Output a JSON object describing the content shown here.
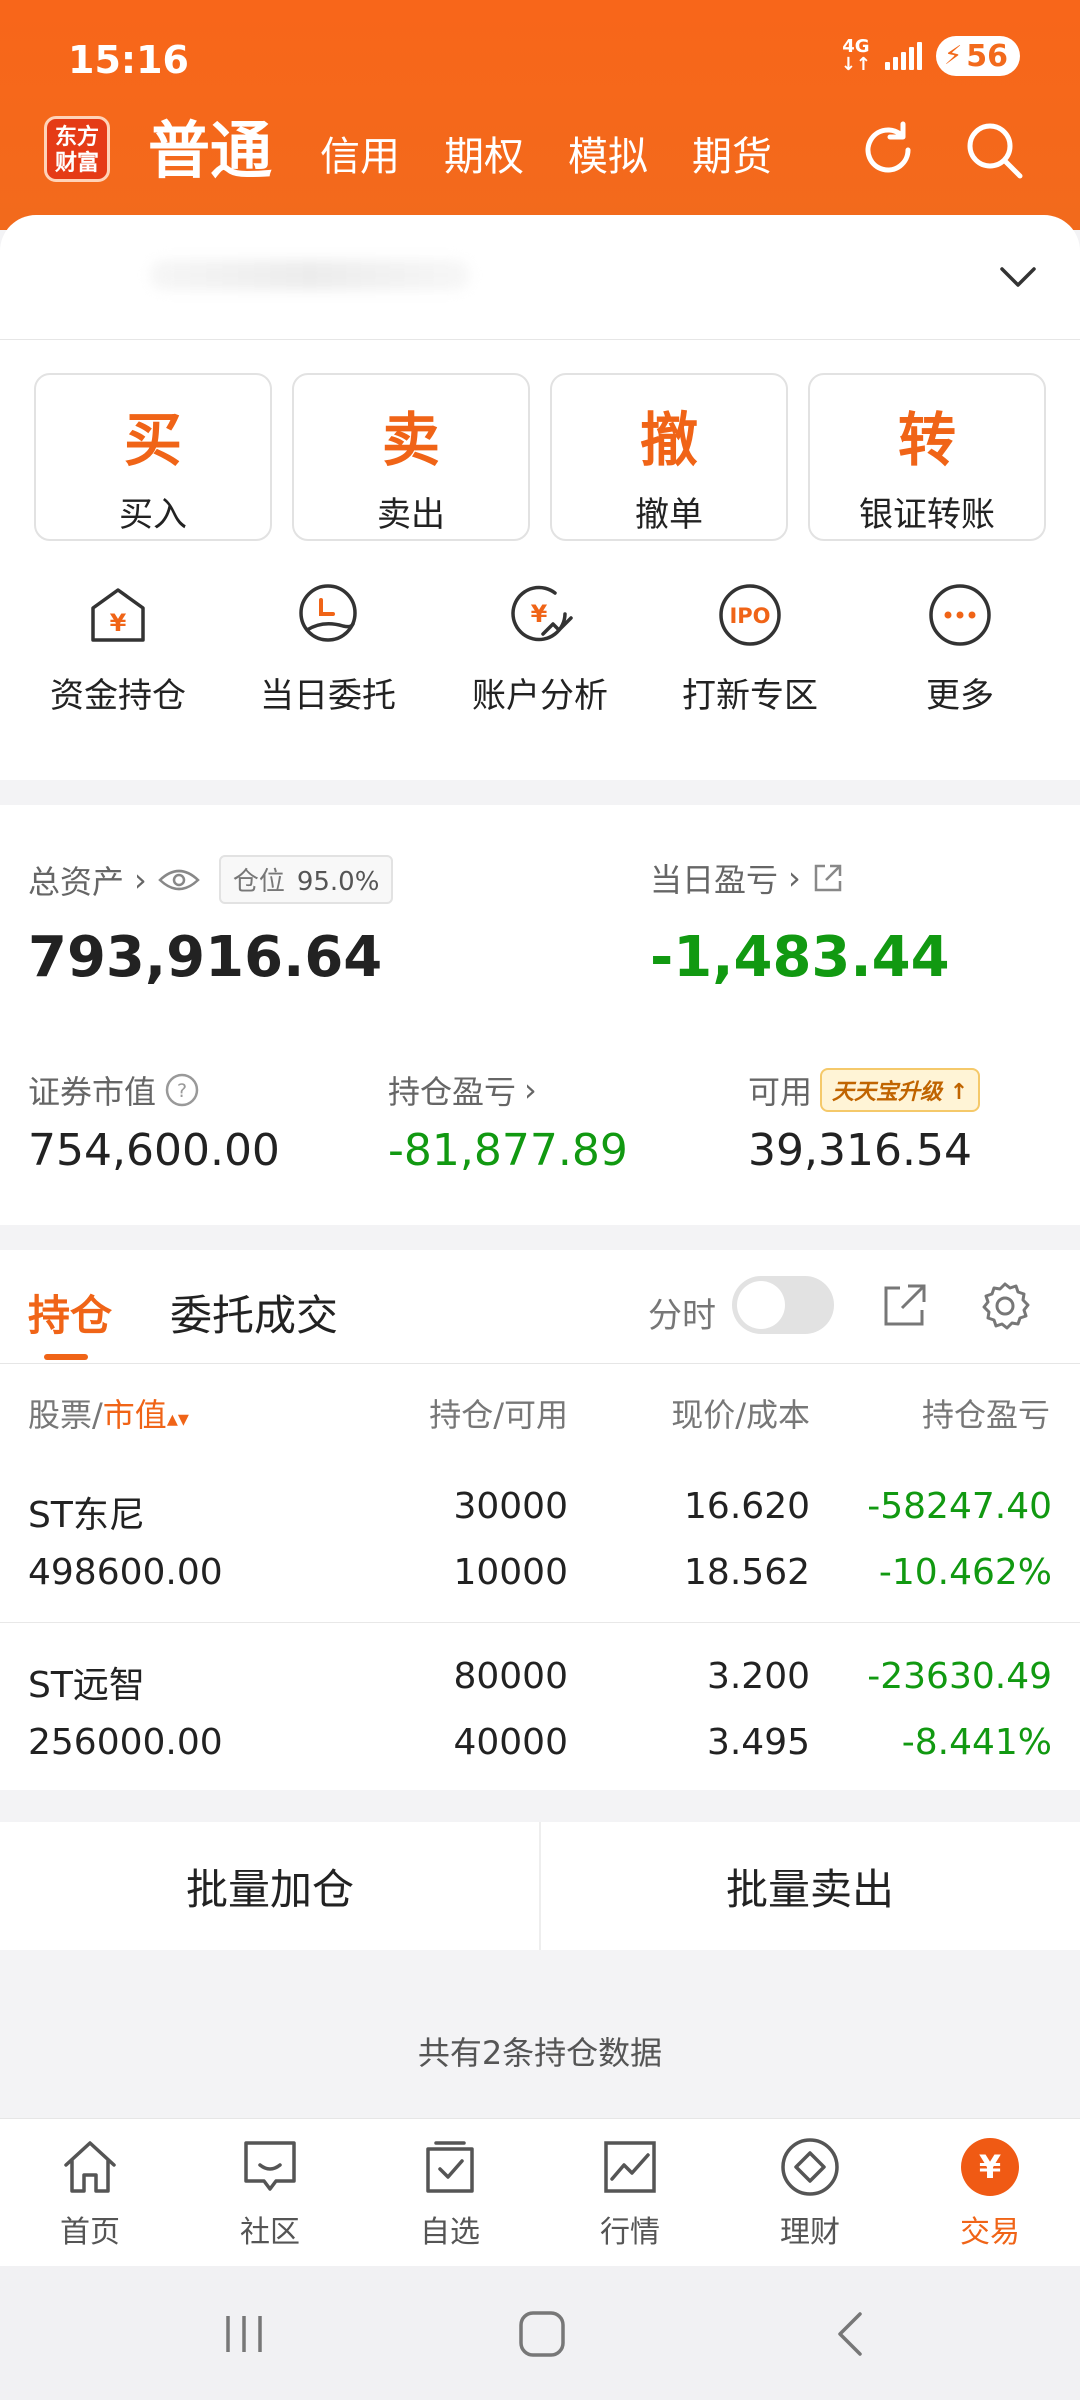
{
  "status_bar": {
    "time": "15:16",
    "network": "4G",
    "battery": "56"
  },
  "app": {
    "logo_line1": "东方",
    "logo_line2": "财富"
  },
  "header": {
    "tabs": [
      {
        "label": "普通",
        "active": true
      },
      {
        "label": "信用",
        "active": false
      },
      {
        "label": "期权",
        "active": false
      },
      {
        "label": "模拟",
        "active": false
      },
      {
        "label": "期货",
        "active": false
      }
    ]
  },
  "actions": [
    {
      "big": "买",
      "label": "买入"
    },
    {
      "big": "卖",
      "label": "卖出"
    },
    {
      "big": "撤",
      "label": "撤单"
    },
    {
      "big": "转",
      "label": "银证转账"
    }
  ],
  "shortcuts": [
    {
      "icon": "funds-house-icon",
      "label": "资金持仓"
    },
    {
      "icon": "clock-hand-icon",
      "label": "当日委托"
    },
    {
      "icon": "yen-chart-icon",
      "label": "账户分析"
    },
    {
      "icon": "ipo-icon",
      "label": "打新专区",
      "icon_text": "IPO"
    },
    {
      "icon": "more-icon",
      "label": "更多"
    }
  ],
  "assets": {
    "total_label": "总资产",
    "position_label": "仓位",
    "position_value": "95.0%",
    "total_value": "793,916.64",
    "day_pl_label": "当日盈亏",
    "day_pl_value": "-1,483.44",
    "market_value_label": "证券市值",
    "market_value": "754,600.00",
    "holding_pl_label": "持仓盈亏",
    "holding_pl_value": "-81,877.89",
    "available_label": "可用",
    "available_value": "39,316.54",
    "upgrade_badge": "天天宝升级"
  },
  "holdings": {
    "tab_positions": "持仓",
    "tab_orders": "委托成交",
    "intraday_label": "分时",
    "intraday_on": false,
    "col_stock": "股票/",
    "col_stock_sort": "市值",
    "col_qty": "持仓/可用",
    "col_price": "现价/成本",
    "col_pl": "持仓盈亏",
    "rows": [
      {
        "name": "ST东尼",
        "market_value": "498600.00",
        "qty": "30000",
        "available": "10000",
        "price": "16.620",
        "cost": "18.562",
        "pl": "-58247.40",
        "pl_pct": "-10.462%"
      },
      {
        "name": "ST远智",
        "market_value": "256000.00",
        "qty": "80000",
        "available": "40000",
        "price": "3.200",
        "cost": "3.495",
        "pl": "-23630.49",
        "pl_pct": "-8.441%"
      }
    ]
  },
  "bulk": {
    "add": "批量加仓",
    "sell": "批量卖出"
  },
  "summary": "共有2条持仓数据",
  "bottom_nav": [
    {
      "label": "首页",
      "icon": "home-icon",
      "active": false
    },
    {
      "label": "社区",
      "icon": "community-icon",
      "active": false
    },
    {
      "label": "自选",
      "icon": "watchlist-icon",
      "active": false
    },
    {
      "label": "行情",
      "icon": "market-icon",
      "active": false
    },
    {
      "label": "理财",
      "icon": "wealth-icon",
      "active": false
    },
    {
      "label": "交易",
      "icon": "trade-icon",
      "active": true,
      "icon_text": "¥"
    }
  ],
  "colors": {
    "brand": "#f06417",
    "loss": "#119911",
    "header": "#f26a1c"
  }
}
